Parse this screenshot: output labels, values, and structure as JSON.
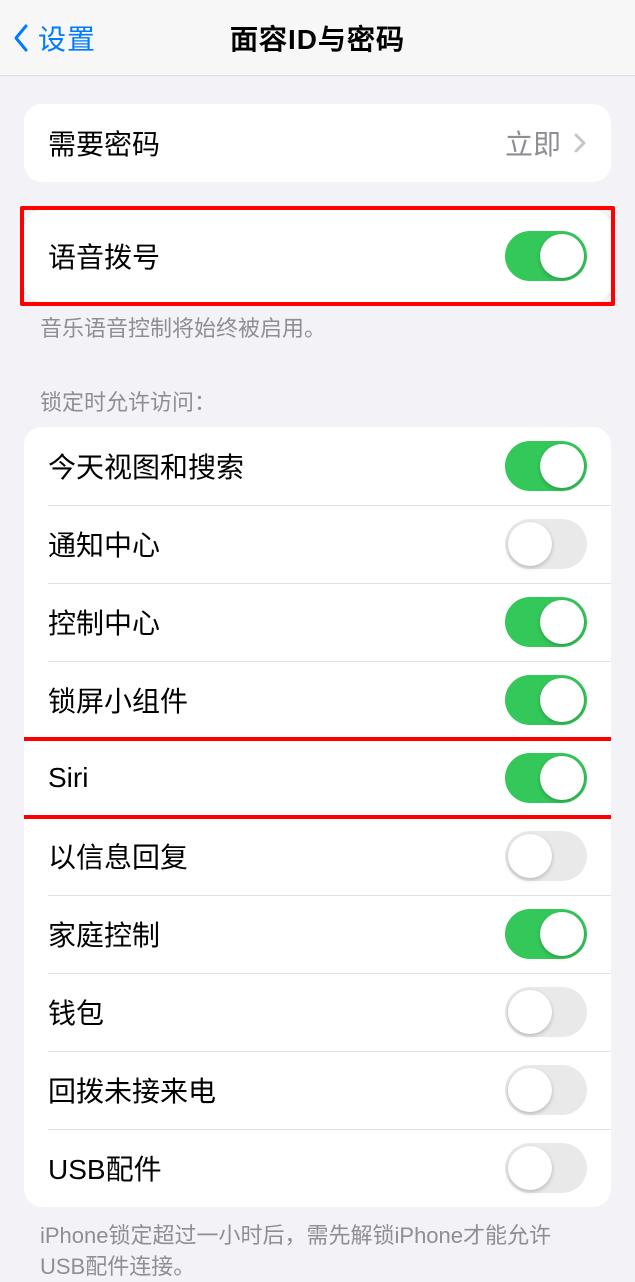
{
  "nav": {
    "back_label": "设置",
    "title": "面容ID与密码"
  },
  "require_passcode": {
    "label": "需要密码",
    "value": "立即"
  },
  "voice_dial": {
    "label": "语音拨号",
    "on": true,
    "footer": "音乐语音控制将始终被启用。"
  },
  "lock_section_header": "锁定时允许访问：",
  "lock_items": [
    {
      "label": "今天视图和搜索",
      "on": true,
      "name": "today-view"
    },
    {
      "label": "通知中心",
      "on": false,
      "name": "notification-center"
    },
    {
      "label": "控制中心",
      "on": true,
      "name": "control-center"
    },
    {
      "label": "锁屏小组件",
      "on": true,
      "name": "lock-screen-widgets"
    },
    {
      "label": "Siri",
      "on": true,
      "name": "siri"
    },
    {
      "label": "以信息回复",
      "on": false,
      "name": "reply-with-message"
    },
    {
      "label": "家庭控制",
      "on": true,
      "name": "home-control"
    },
    {
      "label": "钱包",
      "on": false,
      "name": "wallet"
    },
    {
      "label": "回拨未接来电",
      "on": false,
      "name": "return-missed-calls"
    },
    {
      "label": "USB配件",
      "on": false,
      "name": "usb-accessories"
    }
  ],
  "usb_footer": "iPhone锁定超过一小时后，需先解锁iPhone才能允许USB配件连接。"
}
